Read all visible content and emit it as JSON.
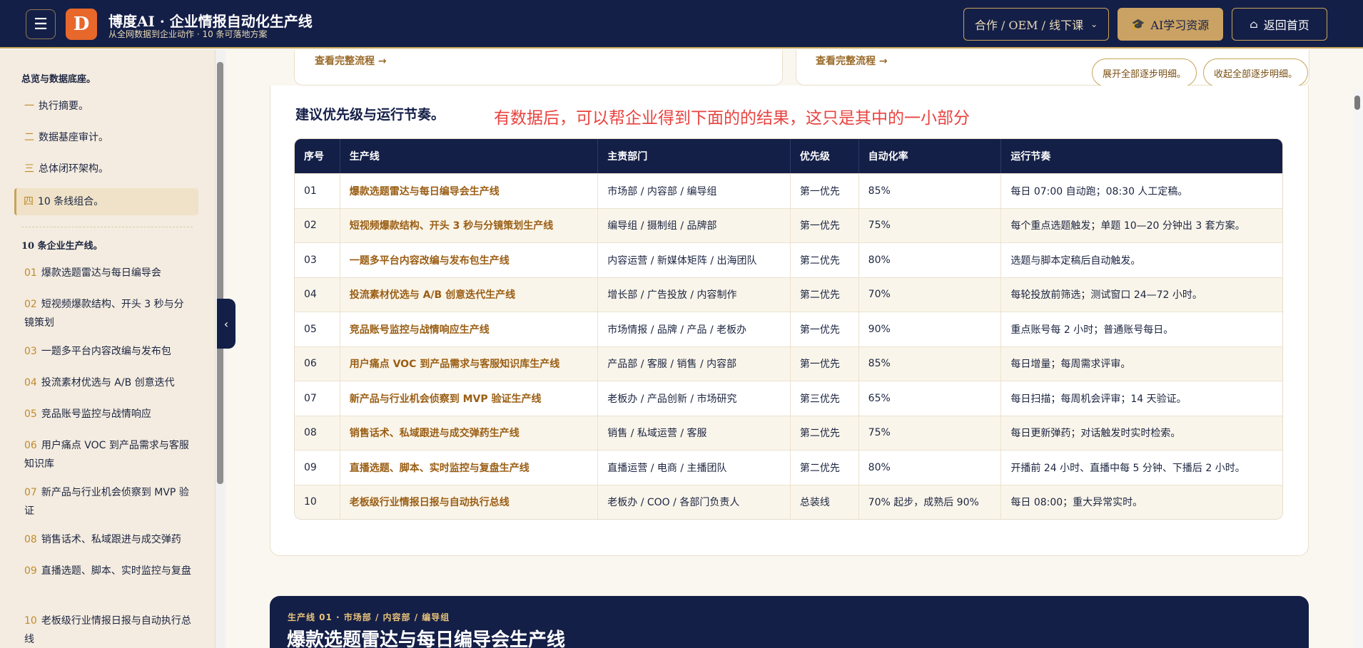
{
  "header": {
    "menu_icon": "hamburger-icon",
    "logo_text": "D",
    "title": "博度AI · 企业情报自动化生产线",
    "subtitle": "从全网数据到企业动作 · 10 条可落地方案",
    "partner_label": "合作 / OEM / 线下课",
    "ai_label": "AI学习资源",
    "home_label": "返回首页"
  },
  "sidebar": {
    "section1": "总览与数据底座。",
    "overview": [
      {
        "num": "一",
        "label": "执行摘要。"
      },
      {
        "num": "二",
        "label": "数据基座审计。"
      },
      {
        "num": "三",
        "label": "总体闭环架构。"
      },
      {
        "num": "四",
        "label": "10 条线组合。"
      }
    ],
    "section2": "10 条企业生产线。",
    "lines": [
      {
        "num": "01",
        "label": "爆款选题雷达与每日编导会"
      },
      {
        "num": "02",
        "label": "短视频爆款结构、开头 3 秒与分镜策划"
      },
      {
        "num": "03",
        "label": "一题多平台内容改编与发布包"
      },
      {
        "num": "04",
        "label": "投流素材优选与 A/B 创意迭代"
      },
      {
        "num": "05",
        "label": "竞品账号监控与战情响应"
      },
      {
        "num": "06",
        "label": "用户痛点 VOC 到产品需求与客服知识库"
      },
      {
        "num": "07",
        "label": "新产品与行业机会侦察到 MVP 验证"
      },
      {
        "num": "08",
        "label": "销售话术、私域跟进与成交弹药"
      },
      {
        "num": "09",
        "label": "直播选题、脚本、实时监控与复盘"
      },
      {
        "num": "10",
        "label": "老板级行业情报日报与自动执行总线"
      }
    ]
  },
  "top_cards": {
    "link1": "查看完整流程 →",
    "link2": "查看完整流程 →",
    "expand_all": "展开全部逐步明细。",
    "collapse_all": "收起全部逐步明细。"
  },
  "section": {
    "title": "建议优先级与运行节奏。",
    "annotation": "有数据后，可以帮企业得到下面的的结果，这只是其中的一小部分"
  },
  "table": {
    "headers": [
      "序号",
      "生产线",
      "主责部门",
      "优先级",
      "自动化率",
      "运行节奏"
    ],
    "rows": [
      [
        "01",
        "爆款选题雷达与每日编导会生产线",
        "市场部 / 内容部 / 编导组",
        "第一优先",
        "85%",
        "每日 07:00 自动跑；08:30 人工定稿。"
      ],
      [
        "02",
        "短视频爆款结构、开头 3 秒与分镜策划生产线",
        "编导组 / 摄制组 / 品牌部",
        "第一优先",
        "75%",
        "每个重点选题触发；单题 10—20 分钟出 3 套方案。"
      ],
      [
        "03",
        "一题多平台内容改编与发布包生产线",
        "内容运营 / 新媒体矩阵 / 出海团队",
        "第二优先",
        "80%",
        "选题与脚本定稿后自动触发。"
      ],
      [
        "04",
        "投流素材优选与 A/B 创意迭代生产线",
        "增长部 / 广告投放 / 内容制作",
        "第二优先",
        "70%",
        "每轮投放前筛选；测试窗口 24—72 小时。"
      ],
      [
        "05",
        "竞品账号监控与战情响应生产线",
        "市场情报 / 品牌 / 产品 / 老板办",
        "第一优先",
        "90%",
        "重点账号每 2 小时；普通账号每日。"
      ],
      [
        "06",
        "用户痛点 VOC 到产品需求与客服知识库生产线",
        "产品部 / 客服 / 销售 / 内容部",
        "第一优先",
        "85%",
        "每日增量；每周需求评审。"
      ],
      [
        "07",
        "新产品与行业机会侦察到 MVP 验证生产线",
        "老板办 / 产品创新 / 市场研究",
        "第三优先",
        "65%",
        "每日扫描；每周机会评审；14 天验证。"
      ],
      [
        "08",
        "销售话术、私域跟进与成交弹药生产线",
        "销售 / 私域运营 / 客服",
        "第二优先",
        "75%",
        "每日更新弹药；对话触发时实时检索。"
      ],
      [
        "09",
        "直播选题、脚本、实时监控与复盘生产线",
        "直播运营 / 电商 / 主播团队",
        "第二优先",
        "80%",
        "开播前 24 小时、直播中每 5 分钟、下播后 2 小时。"
      ],
      [
        "10",
        "老板级行业情报日报与自动执行总线",
        "老板办 / COO / 各部门负责人",
        "总装线",
        "70% 起步，成熟后 90%",
        "每日 08:00；重大异常实时。"
      ]
    ]
  },
  "next_card": {
    "meta": "生产线 01 · 市场部 / 内容部 / 编导组",
    "title": "爆款选题雷达与每日编导会生产线"
  }
}
